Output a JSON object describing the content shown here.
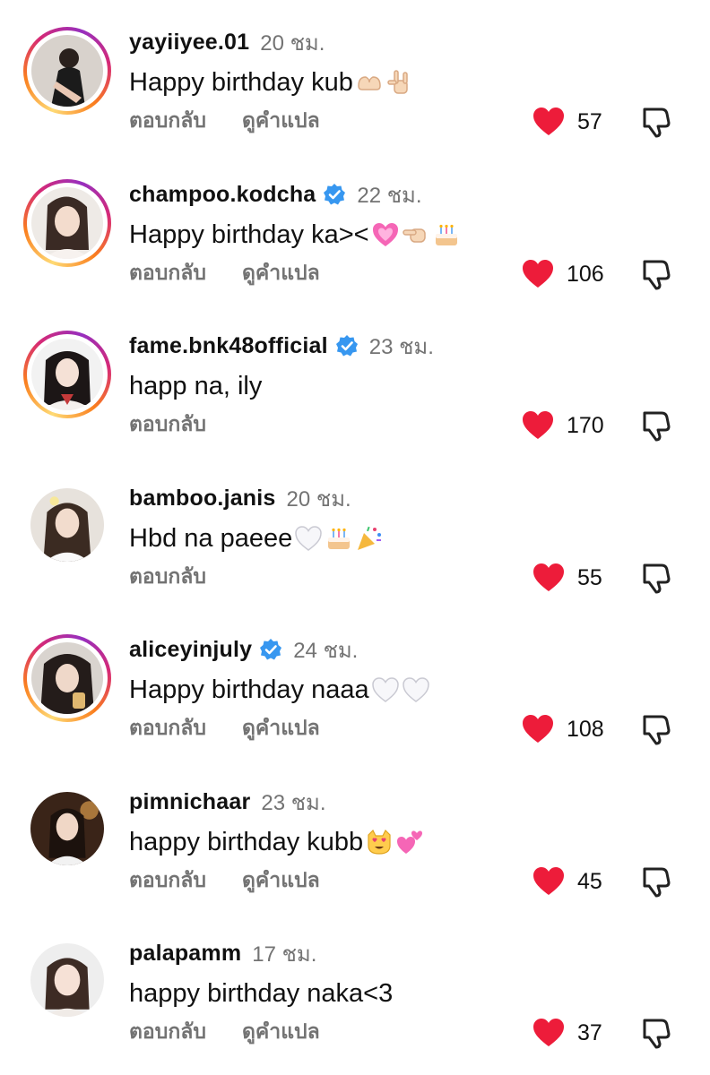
{
  "colors": {
    "heart": "#ed1c3a",
    "muted": "#737373",
    "verified": "#3797f0"
  },
  "comments": [
    {
      "username": "yayiiyee.01",
      "verified": false,
      "time": "20 ชม.",
      "text": "Happy birthday kub",
      "emojis": [
        "heart-hands-emoji",
        "love-you-gesture-emoji"
      ],
      "reply": "ตอบกลับ",
      "translate": "ดูคำแปล",
      "likes": "57",
      "story_ring": true
    },
    {
      "username": "champoo.kodcha",
      "verified": true,
      "time": "22 ชม.",
      "text": "Happy birthday ka><",
      "emojis": [
        "growing-heart-emoji",
        "pointing-hand-emoji",
        "birthday-cake-emoji"
      ],
      "reply": "ตอบกลับ",
      "translate": "ดูคำแปล",
      "likes": "106",
      "story_ring": true
    },
    {
      "username": "fame.bnk48official",
      "verified": true,
      "time": "23 ชม.",
      "text": "happ na, ily",
      "emojis": [],
      "reply": "ตอบกลับ",
      "translate": "",
      "likes": "170",
      "story_ring": true
    },
    {
      "username": "bamboo.janis",
      "verified": false,
      "time": "20 ชม.",
      "text": "Hbd na paeee",
      "emojis": [
        "white-heart-emoji",
        "birthday-cake-emoji",
        "party-popper-emoji"
      ],
      "reply": "ตอบกลับ",
      "translate": "",
      "likes": "55",
      "story_ring": false
    },
    {
      "username": "aliceyinjuly",
      "verified": true,
      "time": "24 ชม.",
      "text": "Happy birthday naaa",
      "emojis": [
        "white-heart-emoji",
        "white-heart-emoji"
      ],
      "reply": "ตอบกลับ",
      "translate": "ดูคำแปล",
      "likes": "108",
      "story_ring": true
    },
    {
      "username": "pimnichaar",
      "verified": false,
      "time": "23 ชม.",
      "text": "happy birthday kubb",
      "emojis": [
        "heart-eyes-cat-emoji",
        "two-hearts-emoji"
      ],
      "reply": "ตอบกลับ",
      "translate": "ดูคำแปล",
      "likes": "45",
      "story_ring": false
    },
    {
      "username": "palapamm",
      "verified": false,
      "time": "17 ชม.",
      "text": "happy birthday naka<3",
      "emojis": [],
      "reply": "ตอบกลับ",
      "translate": "ดูคำแปล",
      "likes": "37",
      "story_ring": false
    }
  ]
}
